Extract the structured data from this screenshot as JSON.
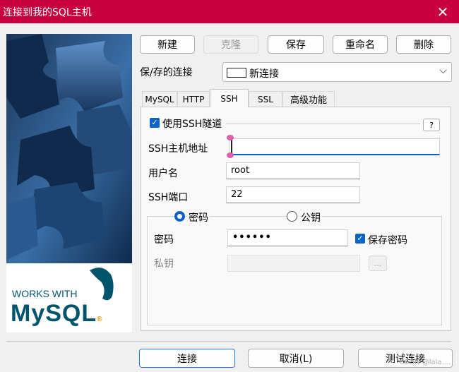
{
  "window": {
    "title": "连接到我的SQL主机"
  },
  "toolbar": {
    "new_label": "新建",
    "clone_label": "克隆",
    "save_label": "保存",
    "rename_label": "重命名",
    "delete_label": "删除"
  },
  "saved_connection": {
    "label": "保/存的连接",
    "value": "新连接"
  },
  "tabs": [
    {
      "label": "MySQL"
    },
    {
      "label": "HTTP"
    },
    {
      "label": "SSH"
    },
    {
      "label": "SSL"
    },
    {
      "label": "高级功能"
    }
  ],
  "active_tab": "SSH",
  "ssh": {
    "use_tunnel_label": "使用SSH隧道",
    "use_tunnel_checked": true,
    "help_label": "?",
    "host_label": "SSH主机地址",
    "host_value": "",
    "user_label": "用户名",
    "user_value": "root",
    "port_label": "SSH端口",
    "port_value": "22",
    "auth_password_label": "密码",
    "auth_key_label": "公钥",
    "auth_selected": "密码",
    "password_label": "密码",
    "password_value": "••••••",
    "save_password_label": "保存密码",
    "save_password_checked": true,
    "private_key_label": "私钥",
    "private_key_value": "",
    "browse_label": "..."
  },
  "footer": {
    "connect_label": "连接",
    "cancel_label": "取消(L)",
    "test_label": "测试连接"
  },
  "sidebar": {
    "works_with_label": "WORKS WITH",
    "logo_text": "MySQL",
    "logo_registered": "®"
  },
  "watermark": "CSDN @lala....",
  "colors": {
    "titlebar": "#c8003f",
    "accent": "#0a64c8",
    "puzzle_dark": "#0f2a4a",
    "puzzle_light": "#2f5f97",
    "mysql_blue": "#00546b",
    "mysql_orange": "#e48e00"
  },
  "icons": {
    "close": "close-icon",
    "dropdown": "chevron-down-icon",
    "connection": "connection-box-icon"
  }
}
